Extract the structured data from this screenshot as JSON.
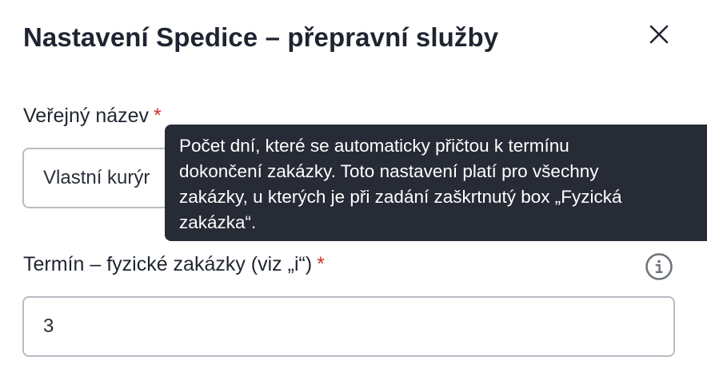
{
  "dialog": {
    "title": "Nastavení Spedice – přepravní služby",
    "close_icon": "close-icon"
  },
  "fields": {
    "public_name": {
      "label": "Veřejný název",
      "required_mark": "*",
      "value": "Vlastní kurýr"
    },
    "physical_term": {
      "label": "Termín – fyzické zakázky (viz „i“)",
      "required_mark": "*",
      "value": "3",
      "info_icon": "info-icon"
    }
  },
  "tooltip": {
    "lines": [
      "Počet dní, které se automaticky přičtou k termínu",
      "dokončení zakázky. Toto nastavení platí pro všechny",
      "zakázky, u kterých je při zadání zaškrtnutý box „Fyzická",
      "zakázka“."
    ]
  },
  "colors": {
    "text": "#1f2530",
    "required": "#c9362e",
    "tooltip_bg": "#262b36",
    "input_border": "#b8bcc3"
  }
}
